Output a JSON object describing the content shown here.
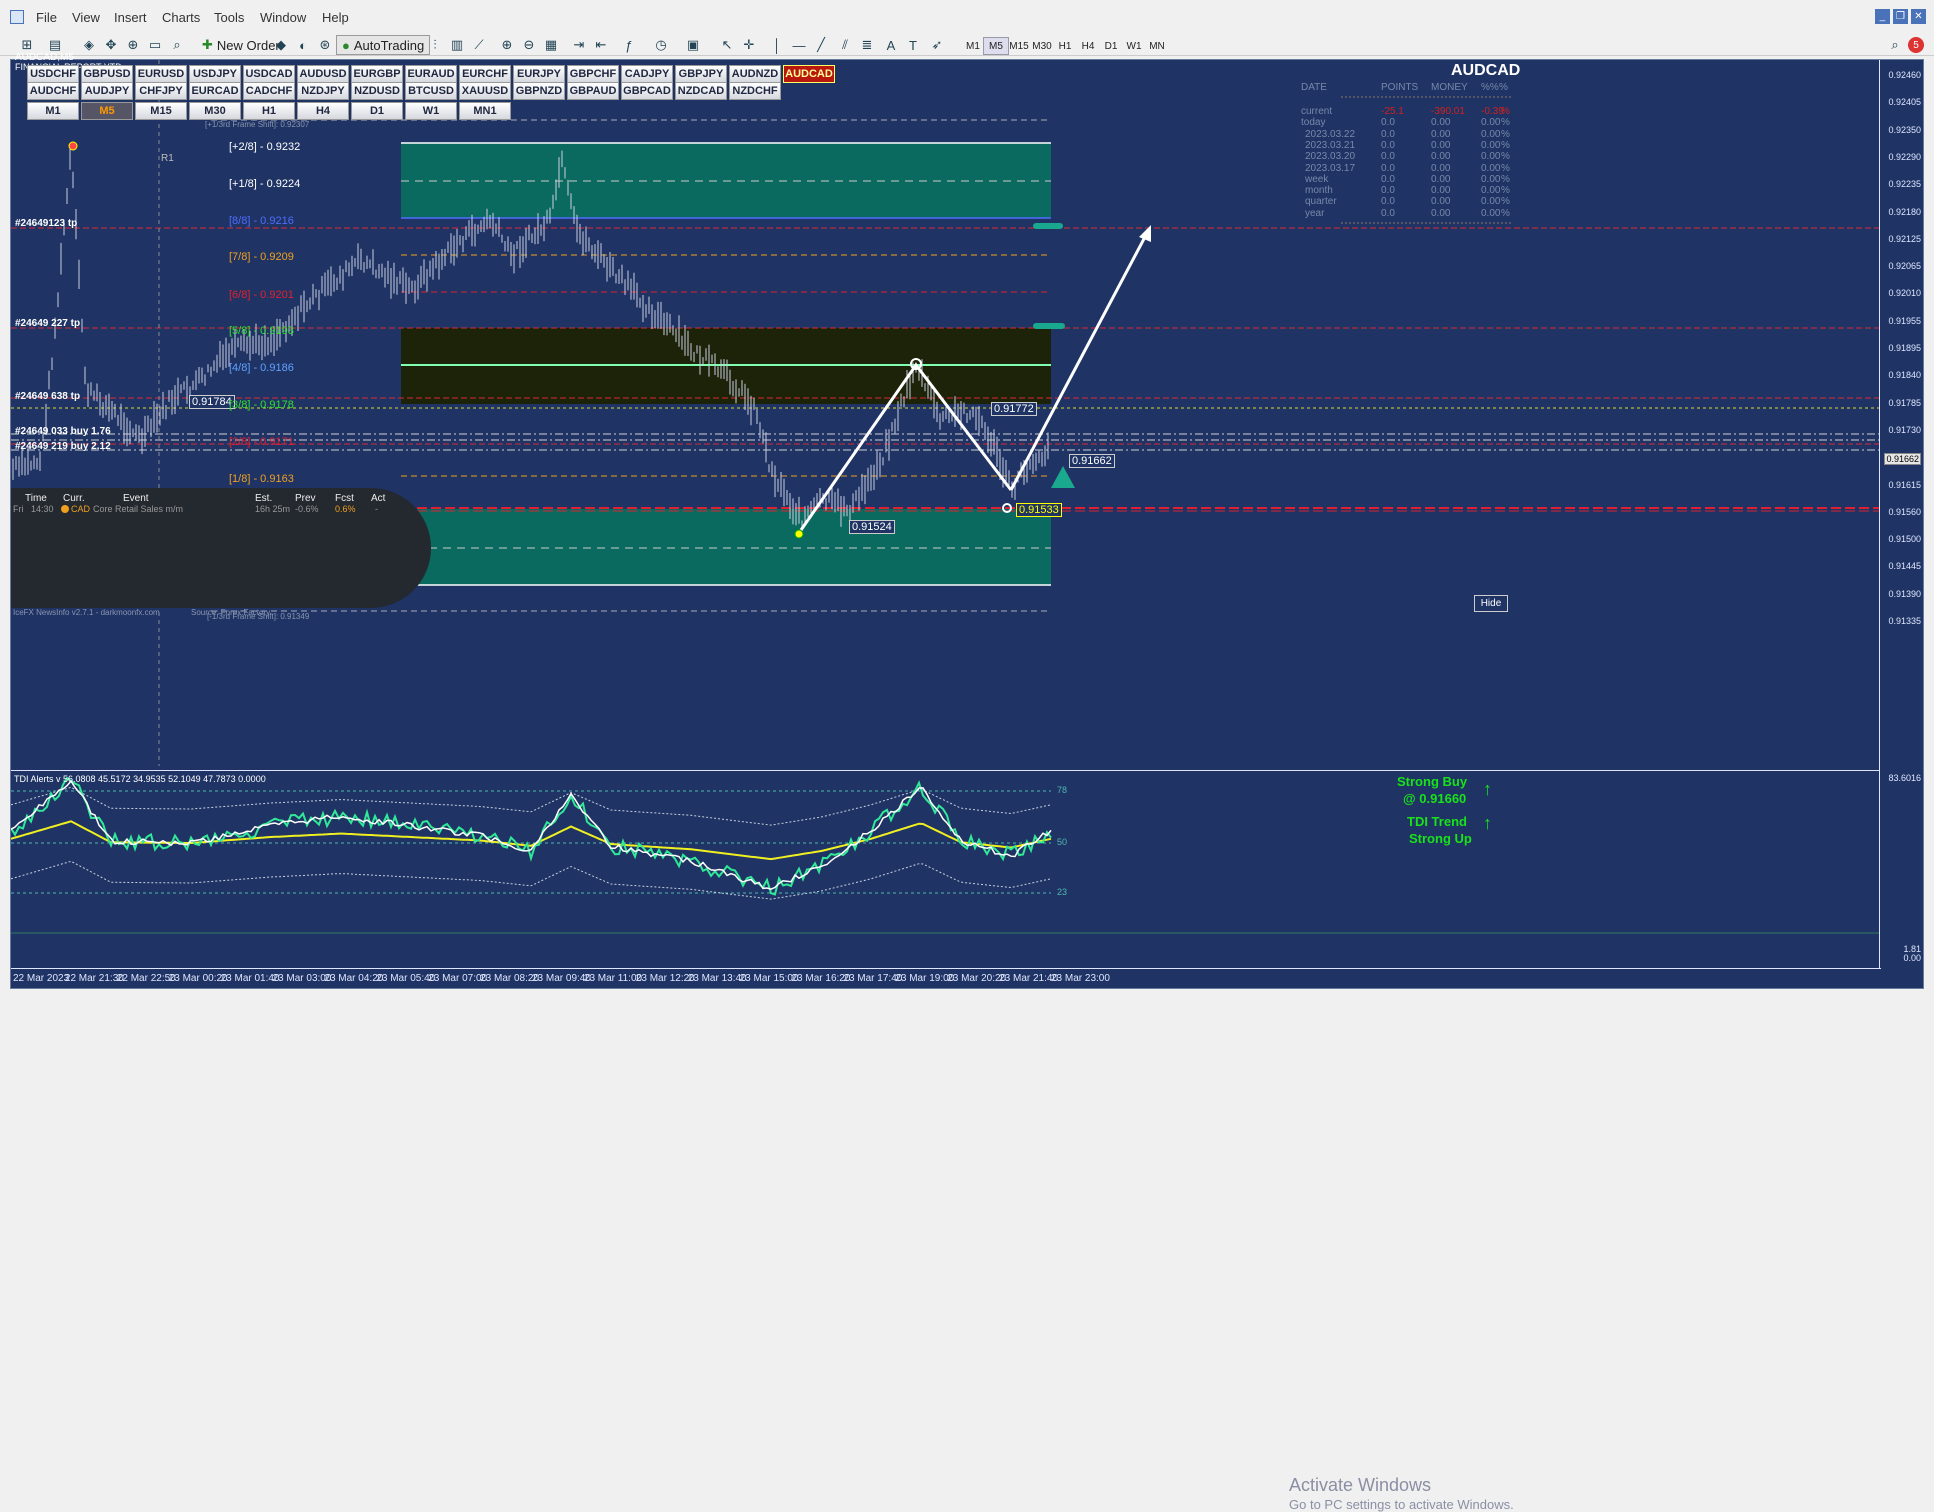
{
  "menu": [
    "File",
    "View",
    "Insert",
    "Charts",
    "Tools",
    "Window",
    "Help"
  ],
  "toolbar": {
    "new_order": "New Order",
    "autotrading": "AutoTrading",
    "timeframes": [
      "M1",
      "M5",
      "M15",
      "M30",
      "H1",
      "H4",
      "D1",
      "W1",
      "MN"
    ],
    "active_tf": "M5",
    "notif_count": "5"
  },
  "chart": {
    "title": "AUDCAD,M5",
    "subtitle": "FINANCIAL REPORT YTD",
    "symbol_display": "AUDCAD",
    "symbols_row1": [
      "USDCHF",
      "GBPUSD",
      "EURUSD",
      "USDJPY",
      "USDCAD",
      "AUDUSD",
      "EURGBP",
      "EURAUD",
      "EURCHF",
      "EURJPY",
      "GBPCHF",
      "CADJPY",
      "GBPJPY",
      "AUDNZD",
      "AUDCAD"
    ],
    "symbols_row2": [
      "AUDCHF",
      "AUDJPY",
      "CHFJPY",
      "EURCAD",
      "CADCHF",
      "NZDJPY",
      "NZDUSD",
      "BTCUSD",
      "XAUUSD",
      "GBPNZD",
      "GBPAUD",
      "GBPCAD",
      "NZDCAD",
      "NZDCHF"
    ],
    "tf_buttons": [
      "M1",
      "M5",
      "M15",
      "M30",
      "H1",
      "H4",
      "D1",
      "W1",
      "MN1"
    ],
    "selected_symbol": "AUDCAD",
    "selected_tf": "M5",
    "r1_label": "R1",
    "frame_shift": "[+1/3rd Frame Shift]: 0.92307",
    "levels": [
      {
        "label": "[+2/8] - 0.9232",
        "color": "#ffffff"
      },
      {
        "label": "[+1/8] - 0.9224",
        "color": "#ffffff"
      },
      {
        "label": "[8/8] - 0.9216",
        "color": "#4f6cff"
      },
      {
        "label": "[7/8] - 0.9209",
        "color": "#f0a020"
      },
      {
        "label": "[6/8] - 0.9201",
        "color": "#e02030"
      },
      {
        "label": "[5/8] - 0.9193",
        "color": "#30e030"
      },
      {
        "label": "[4/8] - 0.9186",
        "color": "#60a0ff"
      },
      {
        "label": "[3/8] - 0.9178",
        "color": "#30e030"
      },
      {
        "label": "[2/8] - 0.9171",
        "color": "#e02030"
      },
      {
        "label": "[1/8] - 0.9163",
        "color": "#f0a020"
      }
    ],
    "orders": [
      "#24649123 tp",
      "#24649 227 tp",
      "#24649 638 tp",
      "#24649 033 buy 1.76",
      "#24649 219 buy 2.12"
    ],
    "price_boxes": {
      "p1": "0.91784",
      "p2": "0.91772",
      "p3": "0.91662",
      "p4": "0.91524",
      "p5": "0.91533"
    },
    "current_price": "0.91662",
    "price_scale": [
      "0.92460",
      "0.92405",
      "0.92350",
      "0.92290",
      "0.92235",
      "0.92180",
      "0.92125",
      "0.92065",
      "0.92010",
      "0.91955",
      "0.91895",
      "0.91840",
      "0.91785",
      "0.91730",
      "0.91670",
      "0.91615",
      "0.91560",
      "0.91500",
      "0.91445",
      "0.91390",
      "0.91335"
    ],
    "tdi_scale_top": "83.6016",
    "tdi_scale_bottom": "0.00",
    "tdi_right_extra": "1.81",
    "time_labels": [
      "22 Mar 2023",
      "22 Mar 21:30",
      "22 Mar 22:50",
      "23 Mar 00:20",
      "23 Mar 01:40",
      "23 Mar 03:00",
      "23 Mar 04:20",
      "23 Mar 05:40",
      "23 Mar 07:00",
      "23 Mar 08:20",
      "23 Mar 09:40",
      "23 Mar 11:00",
      "23 Mar 12:20",
      "23 Mar 13:40",
      "23 Mar 15:00",
      "23 Mar 16:20",
      "23 Mar 17:40",
      "23 Mar 19:00",
      "23 Mar 20:20",
      "23 Mar 21:40",
      "23 Mar 23:00"
    ]
  },
  "report": {
    "headers": [
      "DATE",
      "POINTS",
      "MONEY",
      "%%",
      "%"
    ],
    "rows": [
      {
        "date": "current",
        "points": "-25.1",
        "money": "-390.01",
        "pct": "-0.39",
        "pct2": "%"
      },
      {
        "date": "today",
        "points": "0.0",
        "money": "0.00",
        "pct": "0.00",
        "pct2": "%"
      },
      {
        "date": "2023.03.22",
        "points": "0.0",
        "money": "0.00",
        "pct": "0.00",
        "pct2": "%"
      },
      {
        "date": "2023.03.21",
        "points": "0.0",
        "money": "0.00",
        "pct": "0.00",
        "pct2": "%"
      },
      {
        "date": "2023.03.20",
        "points": "0.0",
        "money": "0.00",
        "pct": "0.00",
        "pct2": "%"
      },
      {
        "date": "2023.03.17",
        "points": "0.0",
        "money": "0.00",
        "pct": "0.00",
        "pct2": "%"
      },
      {
        "date": "week",
        "points": "0.0",
        "money": "0.00",
        "pct": "0.00",
        "pct2": "%"
      },
      {
        "date": "month",
        "points": "0.0",
        "money": "0.00",
        "pct": "0.00",
        "pct2": "%"
      },
      {
        "date": "quarter",
        "points": "0.0",
        "money": "0.00",
        "pct": "0.00",
        "pct2": "%"
      },
      {
        "date": "year",
        "points": "0.0",
        "money": "0.00",
        "pct": "0.00",
        "pct2": "%"
      }
    ]
  },
  "news": {
    "headers": [
      "Time",
      "Curr.",
      "Event",
      "Est.",
      "Prev",
      "Fcst",
      "Act"
    ],
    "row": {
      "day": "Fri",
      "time": "14:30",
      "curr": "CAD",
      "event": "Core Retail Sales m/m",
      "est": "16h 25m",
      "prev": "-0.6%",
      "fcst": "0.6%",
      "act": "-"
    },
    "footer": "IceFX NewsInfo v2.7.1 - darkmoonfx.com",
    "source": "Source: Forex Factory",
    "dollar_shift": "[-1/3rd Frame Shift]: 0.91349"
  },
  "hide_label": "Hide",
  "signals": {
    "strong_buy": "Strong Buy",
    "price": "@ 0.91660",
    "tdi_trend": "TDI Trend",
    "strong_up": "Strong Up",
    "arrow": "↑"
  },
  "tdi": {
    "label": "TDI Alerts v 56.0808 45.5172 34.9535 52.1049 47.7873 0.0000",
    "levels": [
      "78",
      "50",
      "23"
    ]
  },
  "activation": {
    "line1": "Activate Windows",
    "line2": "Go to PC settings to activate Windows."
  },
  "colors": {
    "bg": "#1f3464",
    "teal_box": "#0b6a5f",
    "dark_box": "#1c2308",
    "accent": "#1aa88e",
    "buy_green": "#19e219"
  }
}
